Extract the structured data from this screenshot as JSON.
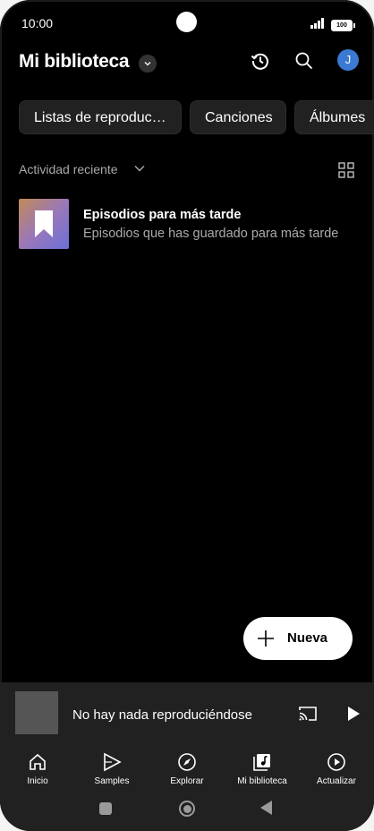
{
  "status_bar": {
    "time": "10:00",
    "battery": "100"
  },
  "header": {
    "title": "Mi biblioteca",
    "avatar_initial": "J",
    "icons": [
      "history-icon",
      "search-icon"
    ]
  },
  "chips": [
    {
      "label": "Listas de reproduc…"
    },
    {
      "label": "Canciones"
    },
    {
      "label": "Álbumes"
    }
  ],
  "recent": {
    "label": "Actividad reciente"
  },
  "library_items": [
    {
      "title": "Episodios para más tarde",
      "subtitle": "Episodios que has guardado para más tarde",
      "icon": "bookmark-icon"
    }
  ],
  "fab": {
    "label": "Nueva"
  },
  "mini_player": {
    "title": "No hay nada reproduciéndose"
  },
  "bottom_nav": [
    {
      "label": "Inicio",
      "icon": "home-icon"
    },
    {
      "label": "Samples",
      "icon": "samples-icon"
    },
    {
      "label": "Explorar",
      "icon": "compass-icon"
    },
    {
      "label": "Mi biblioteca",
      "icon": "library-icon"
    },
    {
      "label": "Actualizar",
      "icon": "upgrade-icon"
    }
  ],
  "colors": {
    "background": "#000000",
    "surface": "#212121",
    "avatar": "#3b79d3",
    "secondary_text": "#aaaaaa"
  }
}
